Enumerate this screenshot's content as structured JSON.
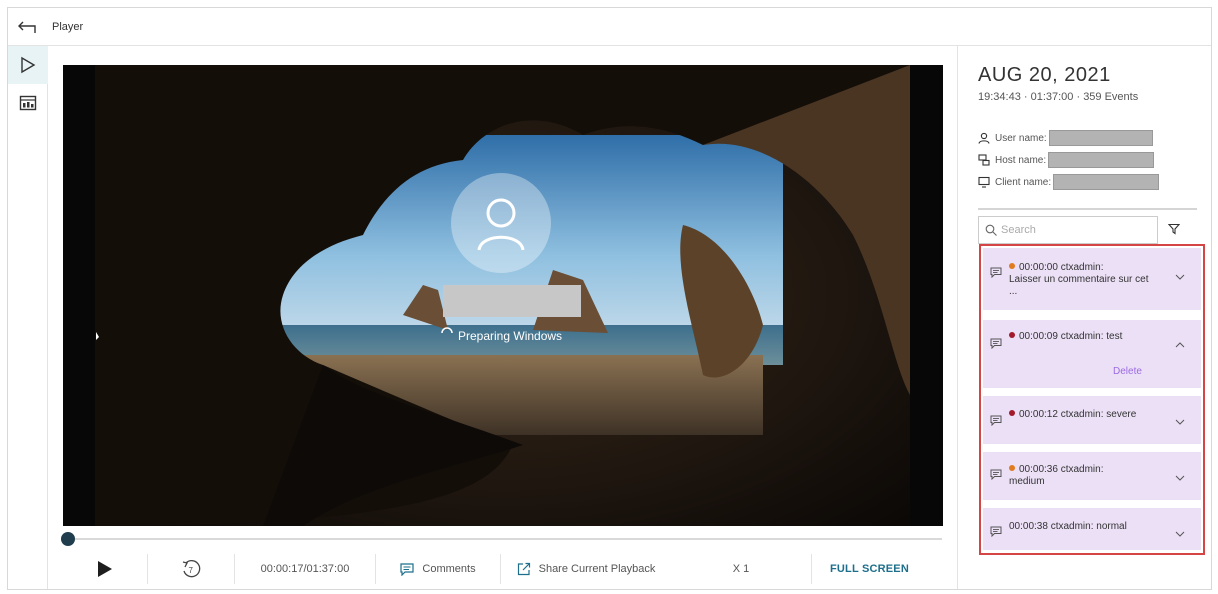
{
  "header": {
    "title": "Player"
  },
  "player": {
    "overlay_text": "Preparing Windows",
    "progress_fraction": 0.0028,
    "time": "00:00:17/01:37:00",
    "comments_label": "Comments",
    "share_label": "Share Current Playback",
    "speed": "X 1",
    "fullscreen_label": "FULL SCREEN"
  },
  "session": {
    "date": "AUG 20, 2021",
    "meta": "19:34:43 · 01:37:00 · 359 Events",
    "user_label": "User name:",
    "host_label": "Host name:",
    "client_label": "Client name:"
  },
  "search": {
    "placeholder": "Search"
  },
  "events": [
    {
      "time_user": "00:00:00 ctxadmin:",
      "text": "Laisser un commentaire sur cet ...",
      "dot_color": "#e07b1f",
      "expanded": false
    },
    {
      "time_user": "00:00:09 ctxadmin: test",
      "text": "",
      "dot_color": "#a31a2b",
      "expanded": true,
      "action": "Delete"
    },
    {
      "time_user": "00:00:12 ctxadmin: severe",
      "text": "",
      "dot_color": "#a31a2b",
      "expanded": false
    },
    {
      "time_user": "00:00:36 ctxadmin:",
      "text": "medium",
      "dot_color": "#e07b1f",
      "expanded": false
    },
    {
      "time_user": "00:00:38 ctxadmin: normal",
      "text": "",
      "dot_color": "",
      "expanded": false
    }
  ]
}
